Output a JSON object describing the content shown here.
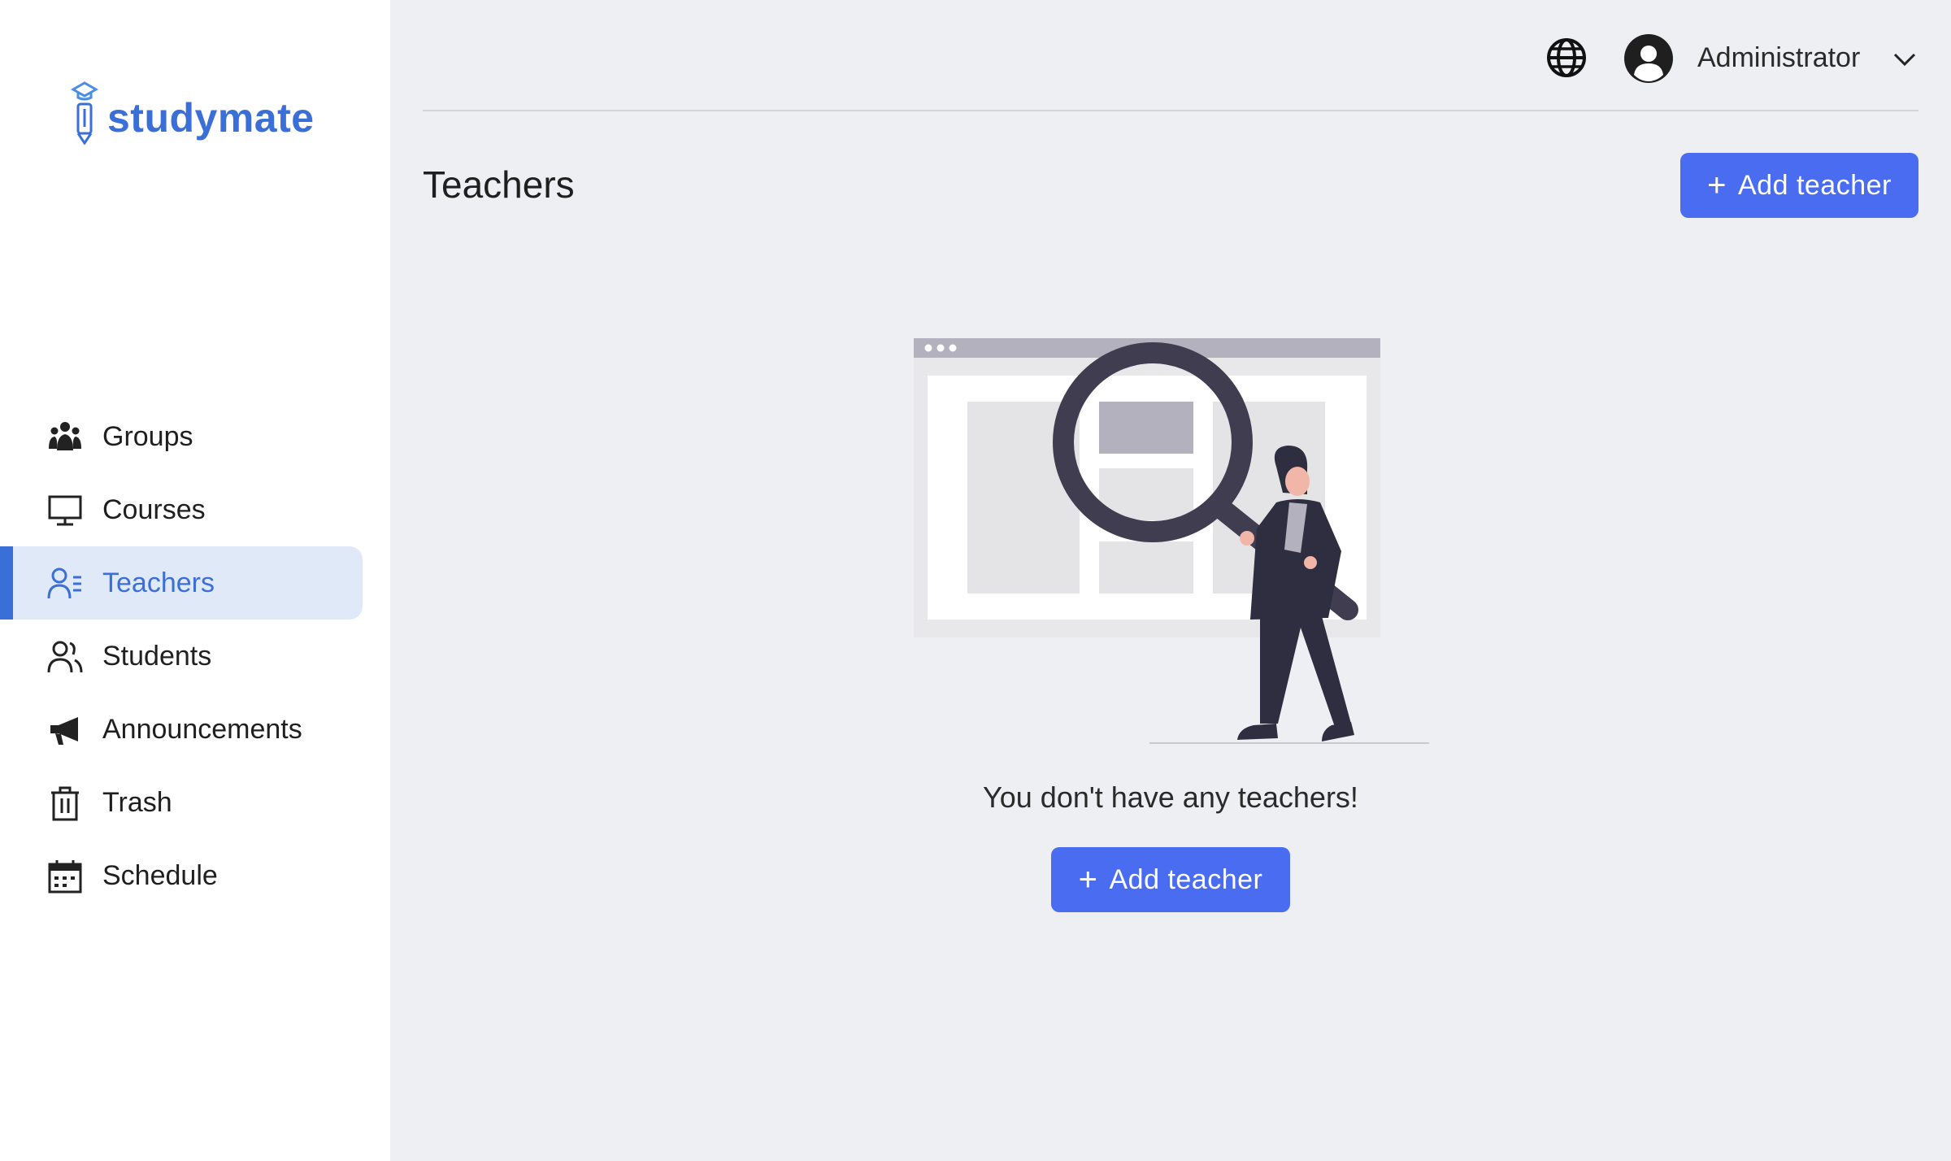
{
  "brand": {
    "name": "studymate",
    "color": "#3b6fd8"
  },
  "sidebar": {
    "items": [
      {
        "label": "Groups",
        "icon": "groups-icon"
      },
      {
        "label": "Courses",
        "icon": "monitor-icon"
      },
      {
        "label": "Teachers",
        "icon": "teacher-icon",
        "active": true
      },
      {
        "label": "Students",
        "icon": "students-icon"
      },
      {
        "label": "Announcements",
        "icon": "megaphone-icon"
      },
      {
        "label": "Trash",
        "icon": "trash-icon"
      },
      {
        "label": "Schedule",
        "icon": "calendar-icon"
      }
    ]
  },
  "header": {
    "language_icon": "globe-icon",
    "user_name": "Administrator",
    "user_menu_icon": "chevron-down-icon"
  },
  "main": {
    "title": "Teachers",
    "add_button_label": "Add teacher",
    "empty_message": "You don't have any teachers!",
    "empty_add_button_label": "Add teacher"
  },
  "colors": {
    "accent": "#4a6cf0",
    "active_bg": "#e0e9f8",
    "background": "#eeeff3"
  }
}
